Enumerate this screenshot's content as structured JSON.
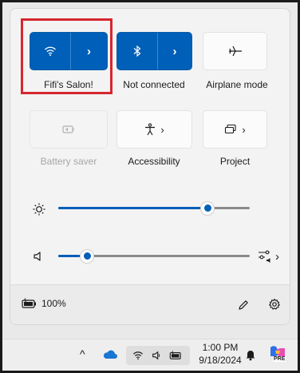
{
  "quick_settings": {
    "wifi": {
      "label": "Fifi's Salon!",
      "icon": "wifi-icon",
      "state": "on"
    },
    "bluetooth": {
      "label": "Not connected",
      "icon": "bluetooth-icon",
      "state": "on"
    },
    "airplane": {
      "label": "Airplane mode",
      "icon": "airplane-icon",
      "state": "off"
    },
    "battery_saver": {
      "label": "Battery saver",
      "icon": "battery-saver-icon",
      "state": "disabled"
    },
    "accessibility": {
      "label": "Accessibility",
      "icon": "accessibility-icon"
    },
    "project": {
      "label": "Project",
      "icon": "project-icon"
    }
  },
  "sliders": {
    "brightness": {
      "icon": "brightness-icon",
      "level": 0.78
    },
    "volume": {
      "icon": "speaker-icon",
      "level": 0.15
    }
  },
  "footer": {
    "battery_percent": "100%",
    "battery_icon": "battery-charging-icon",
    "edit_icon": "pencil-icon",
    "settings_icon": "gear-icon"
  },
  "taskbar": {
    "time": "1:00 PM",
    "date": "9/18/2024",
    "pre_badge": "PRE"
  },
  "colors": {
    "accent": "#005fb8",
    "highlight_border": "#d6262e"
  }
}
